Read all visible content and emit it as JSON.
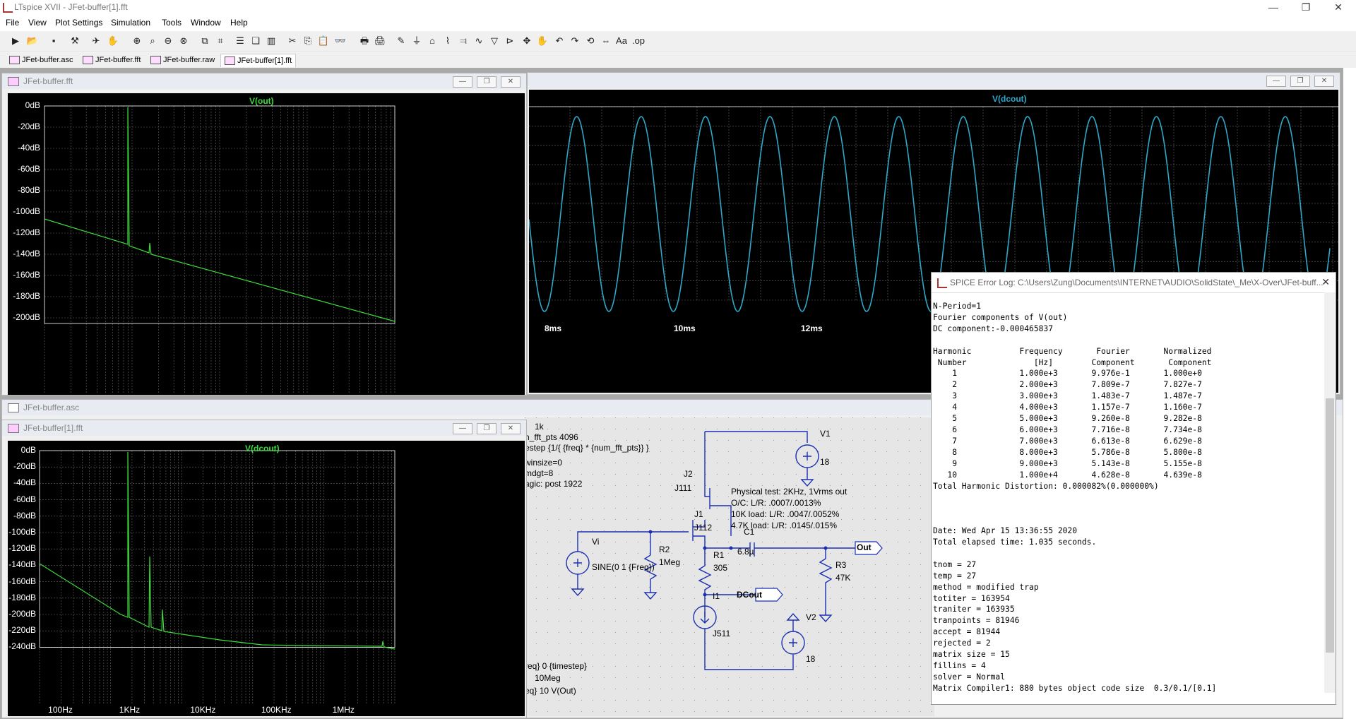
{
  "app": {
    "title": "LTspice XVII - JFet-buffer[1].fft",
    "controls": {
      "minimize": "—",
      "restore": "❐",
      "close": "✕"
    }
  },
  "menu": [
    "File",
    "View",
    "Plot Settings",
    "Simulation",
    "Tools",
    "Window",
    "Help"
  ],
  "tabs": [
    {
      "label": "JFet-buffer.asc",
      "icon": "schematic-icon"
    },
    {
      "label": "JFet-buffer.fft",
      "icon": "waveform-icon"
    },
    {
      "label": "JFet-buffer.raw",
      "icon": "waveform-icon"
    },
    {
      "label": "JFet-buffer[1].fft",
      "icon": "waveform-icon",
      "active": true
    }
  ],
  "windows": {
    "fft_top": {
      "title": "JFet-buffer.fft",
      "trace": "V(out)",
      "trace_color": "#3cdc3c",
      "y_ticks": [
        "0dB",
        "-20dB",
        "-40dB",
        "-60dB",
        "-80dB",
        "-100dB",
        "-120dB",
        "-140dB",
        "-160dB",
        "-180dB",
        "-200dB"
      ]
    },
    "transient": {
      "trace": "V(dcout)",
      "trace_color": "#2fa8c8",
      "x_ticks": [
        "8ms",
        "10ms",
        "12ms"
      ],
      "x_tick_partial": "ms"
    },
    "schematic": {
      "title": "JFet-buffer.asc",
      "directives": [
        "1k",
        "n_fft_pts 4096",
        "estep {1/{ {freq} * {num_fft_pts}} }",
        "winsize=0",
        "mdgt=8",
        "agic: post 1922",
        "req} 0 {timestep}",
        "10Meg",
        "eq} 10 V(Out)"
      ],
      "notes": [
        "Physical test: 2KHz, 1Vrms out",
        "O/C: L/R: .0007/.0013%",
        "10K load: L/R: .0047/.0052%",
        "4.7K load: L/R: .0145/.015%"
      ],
      "components": {
        "V1": "V1",
        "V1_val": "18",
        "V2": "V2",
        "V2_val": "18",
        "J2": "J2",
        "J2_model": "J111",
        "J1": "J1",
        "J1_model": "J112",
        "Vi": "Vi",
        "Vi_val": "SINE(0 1 {Freq})",
        "R2": "R2",
        "R2_val": "1Meg",
        "R1": "R1",
        "R1_val": "305",
        "C1": "C1",
        "C1_val": "6.8µ",
        "R3": "R3",
        "R3_val": "47K",
        "I1": "I1",
        "I1_model": "J511",
        "Out": "Out",
        "DCout": "DCout"
      }
    },
    "fft_bottom": {
      "title": "JFet-buffer[1].fft",
      "trace": "V(dcout)",
      "trace_color": "#3cdc3c",
      "y_ticks": [
        "0dB",
        "-20dB",
        "-40dB",
        "-60dB",
        "-80dB",
        "-100dB",
        "-120dB",
        "-140dB",
        "-160dB",
        "-180dB",
        "-200dB",
        "-220dB",
        "-240dB"
      ],
      "x_ticks": [
        "100Hz",
        "1KHz",
        "10KHz",
        "100KHz",
        "1MHz"
      ]
    },
    "errlog": {
      "title": "SPICE Error Log: C:\\Users\\Zung\\Documents\\INTERNET\\AUDIO\\SolidState\\_Me\\X-Over\\JFet-buff...",
      "lines": [
        "N-Period=1",
        "Fourier components of V(out)",
        "DC component:-0.000465837",
        "",
        "Harmonic          Frequency       Fourier       Normalized",
        " Number              [Hz]        Component       Component",
        "    1             1.000e+3       9.976e-1       1.000e+0",
        "    2             2.000e+3       7.809e-7       7.827e-7",
        "    3             3.000e+3       1.483e-7       1.487e-7",
        "    4             4.000e+3       1.157e-7       1.160e-7",
        "    5             5.000e+3       9.260e-8       9.282e-8",
        "    6             6.000e+3       7.716e-8       7.734e-8",
        "    7             7.000e+3       6.613e-8       6.629e-8",
        "    8             8.000e+3       5.786e-8       5.800e-8",
        "    9             9.000e+3       5.143e-8       5.155e-8",
        "   10             1.000e+4       4.628e-8       4.639e-8",
        "Total Harmonic Distortion: 0.000082%(0.000000%)",
        "",
        "",
        "",
        "Date: Wed Apr 15 13:36:55 2020",
        "Total elapsed time: 1.035 seconds.",
        "",
        "tnom = 27",
        "temp = 27",
        "method = modified trap",
        "totiter = 163954",
        "traniter = 163935",
        "tranpoints = 81946",
        "accept = 81944",
        "rejected = 2",
        "matrix size = 15",
        "fillins = 4",
        "solver = Normal",
        "Matrix Compiler1: 880 bytes object code size  0.3/0.1/[0.1]"
      ]
    }
  }
}
